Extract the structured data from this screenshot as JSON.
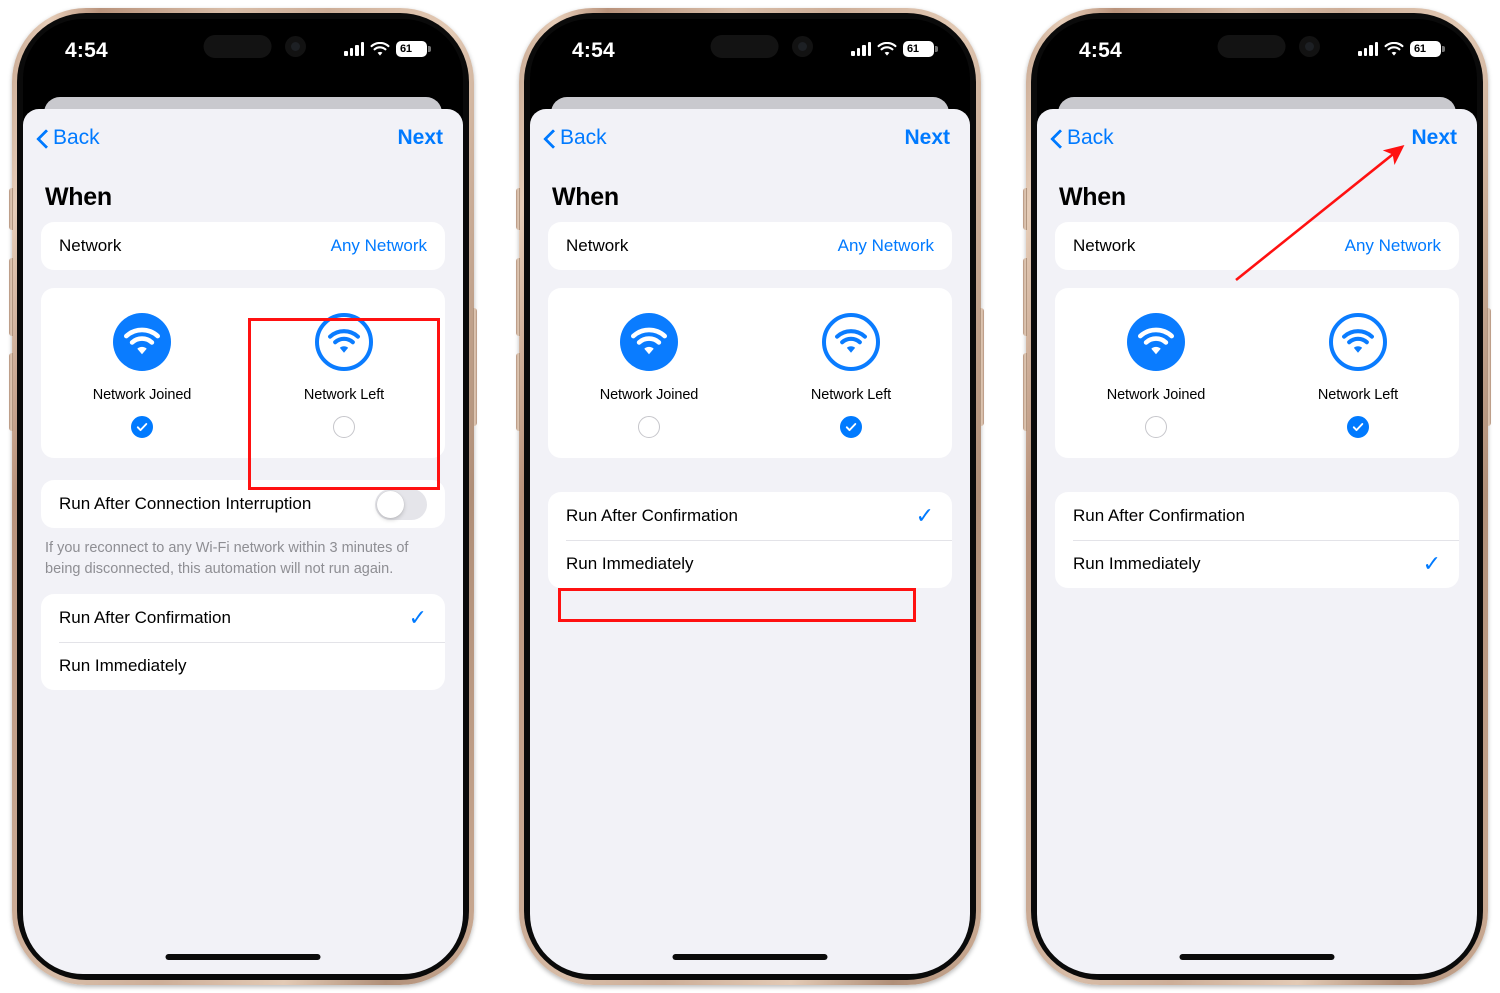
{
  "status_bar": {
    "time": "4:54",
    "battery_level": "61",
    "cellular_icon": "cellular-signal-icon",
    "wifi_icon": "wifi-status-icon",
    "battery_icon": "battery-icon"
  },
  "nav": {
    "back_label": "Back",
    "next_label": "Next",
    "back_icon": "chevron-left-icon"
  },
  "heading": "When",
  "network_row": {
    "label": "Network",
    "value": "Any Network"
  },
  "choices": {
    "joined": {
      "label": "Network Joined",
      "icon": "wifi-filled-circle-icon"
    },
    "left": {
      "label": "Network Left",
      "icon": "wifi-outline-circle-icon"
    }
  },
  "interruption": {
    "label": "Run After Connection Interruption",
    "toggle_state": "off",
    "footnote": "If you reconnect to any Wi-Fi network within 3 minutes of being disconnected, this automation will not run again."
  },
  "run_options": {
    "confirmation_label": "Run After Confirmation",
    "immediately_label": "Run Immediately",
    "check_glyph": "✓"
  },
  "colors": {
    "accent_blue": "#007AFF",
    "annotation_red": "#FF1111",
    "sheet_bg": "#F2F2F7",
    "card_bg": "#FFFFFF",
    "footnote_gray": "#8E8E93",
    "radio_gray": "#C6C6CB",
    "toggle_off": "#E5E5EA"
  },
  "panels": [
    {
      "id": "panel-1",
      "selected_trigger": "joined",
      "selected_run_option": "confirmation",
      "show_interruption_section": true,
      "annotation": "red-box-around-network-left-choice"
    },
    {
      "id": "panel-2",
      "selected_trigger": "left",
      "selected_run_option": "confirmation",
      "show_interruption_section": false,
      "annotation": "red-box-around-run-immediately-row"
    },
    {
      "id": "panel-3",
      "selected_trigger": "left",
      "selected_run_option": "immediately",
      "show_interruption_section": false,
      "annotation": "red-arrow-pointing-to-next-button"
    }
  ]
}
